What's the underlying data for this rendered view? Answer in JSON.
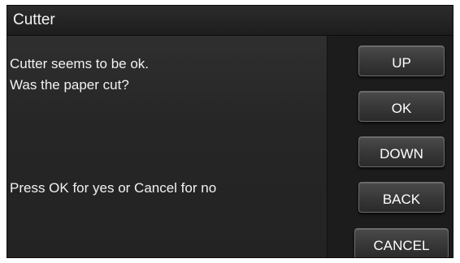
{
  "dialog": {
    "title": "Cutter",
    "messages": [
      "Cutter seems to be ok.",
      "Was the paper cut?",
      "Press OK for yes or Cancel for no"
    ]
  },
  "buttons": {
    "up": "UP",
    "ok": "OK",
    "down": "DOWN",
    "back": "BACK",
    "cancel": "CANCEL"
  }
}
